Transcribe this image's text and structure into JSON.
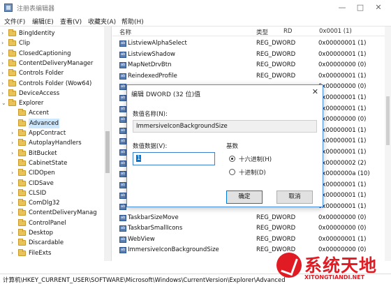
{
  "window": {
    "title": "注册表编辑器",
    "minimize": "—",
    "maximize": "□",
    "close": "✕"
  },
  "menu": [
    "文件(F)",
    "编辑(E)",
    "查看(V)",
    "收藏夹(A)",
    "帮助(H)"
  ],
  "tree": [
    {
      "label": "BingIdentity",
      "expand": "›"
    },
    {
      "label": "Clip",
      "expand": "›"
    },
    {
      "label": "ClosedCaptioning",
      "expand": "›"
    },
    {
      "label": "ContentDeliveryManager",
      "expand": "›"
    },
    {
      "label": "Controls Folder",
      "expand": "›"
    },
    {
      "label": "Controls Folder (Wow64)",
      "expand": "›"
    },
    {
      "label": "DeviceAccess",
      "expand": "›"
    },
    {
      "label": "Explorer",
      "expand": "⌄"
    },
    {
      "label": "Accent",
      "expand": ""
    },
    {
      "label": "Advanced",
      "expand": ""
    },
    {
      "label": "AppContract",
      "expand": "›"
    },
    {
      "label": "AutoplayHandlers",
      "expand": "›"
    },
    {
      "label": "BitBucket",
      "expand": "›"
    },
    {
      "label": "CabinetState",
      "expand": ""
    },
    {
      "label": "CIDOpen",
      "expand": "›"
    },
    {
      "label": "CIDSave",
      "expand": "›"
    },
    {
      "label": "CLSID",
      "expand": "›"
    },
    {
      "label": "ComDlg32",
      "expand": "›"
    },
    {
      "label": "ContentDeliveryManag",
      "expand": "›"
    },
    {
      "label": "ControlPanel",
      "expand": ""
    },
    {
      "label": "Desktop",
      "expand": "›"
    },
    {
      "label": "Discardable",
      "expand": "›"
    },
    {
      "label": "FileExts",
      "expand": "›"
    }
  ],
  "columns": {
    "name": "名称",
    "type": "类型"
  },
  "top_partial": {
    "type": "RD",
    "data": "0x0001 (1)"
  },
  "values": [
    {
      "name": "ListviewAlphaSelect",
      "type": "REG_DWORD",
      "data": "0x00000001 (1)"
    },
    {
      "name": "ListviewShadow",
      "type": "REG_DWORD",
      "data": "0x00000001 (1)"
    },
    {
      "name": "MapNetDrvBtn",
      "type": "REG_DWORD",
      "data": "0x00000000 (0)"
    },
    {
      "name": "ReindexedProfile",
      "type": "REG_DWORD",
      "data": "0x00000001 (1)"
    },
    {
      "name": "",
      "type": "",
      "data": "0x00000000 (0)"
    },
    {
      "name": "",
      "type": "",
      "data": "0x00000001 (1)"
    },
    {
      "name": "",
      "type": "",
      "data": "0x00000001 (1)"
    },
    {
      "name": "",
      "type": "",
      "data": "0x00000000 (0)"
    },
    {
      "name": "",
      "type": "",
      "data": "0x00000001 (1)"
    },
    {
      "name": "",
      "type": "",
      "data": "0x00000001 (1)"
    },
    {
      "name": "",
      "type": "",
      "data": "0x00000001 (1)"
    },
    {
      "name": "",
      "type": "",
      "data": "0x00000002 (2)"
    },
    {
      "name": "",
      "type": "",
      "data": "0x0000000a (10)"
    },
    {
      "name": "",
      "type": "",
      "data": "0x00000001 (1)"
    },
    {
      "name": "",
      "type": "",
      "data": "0x00000001 (1)"
    },
    {
      "name": "",
      "type": "",
      "data": "0x00000001 (1)"
    },
    {
      "name": "TaskbarSizeMove",
      "type": "REG_DWORD",
      "data": "0x00000000 (0)"
    },
    {
      "name": "TaskbarSmallIcons",
      "type": "REG_DWORD",
      "data": "0x00000000 (0)"
    },
    {
      "name": "WebView",
      "type": "REG_DWORD",
      "data": "0x00000001 (1)"
    },
    {
      "name": "ImmersiveIconBackgroundSize",
      "type": "REG_DWORD",
      "data": "0x00000000 (0)"
    }
  ],
  "status": "计算机\\HKEY_CURRENT_USER\\SOFTWARE\\Microsoft\\Windows\\CurrentVersion\\Explorer\\Advanced",
  "dialog": {
    "title": "编辑 DWORD (32 位)值",
    "close": "✕",
    "name_label": "数值名称(N):",
    "name_value": "ImmersiveIconBackgroundSize",
    "data_label": "数值数据(V):",
    "data_value": "1",
    "base_label": "基数",
    "hex_label": "十六进制(H)",
    "dec_label": "十进制(D)",
    "ok": "确定",
    "cancel": "取消"
  },
  "logo": {
    "cn": "系统天地",
    "en": "XITONGTIANDI.NET"
  },
  "colors": {
    "selection": "#cce8ff",
    "dialog_border": "#4a90e2",
    "logo": "#e01b24"
  }
}
